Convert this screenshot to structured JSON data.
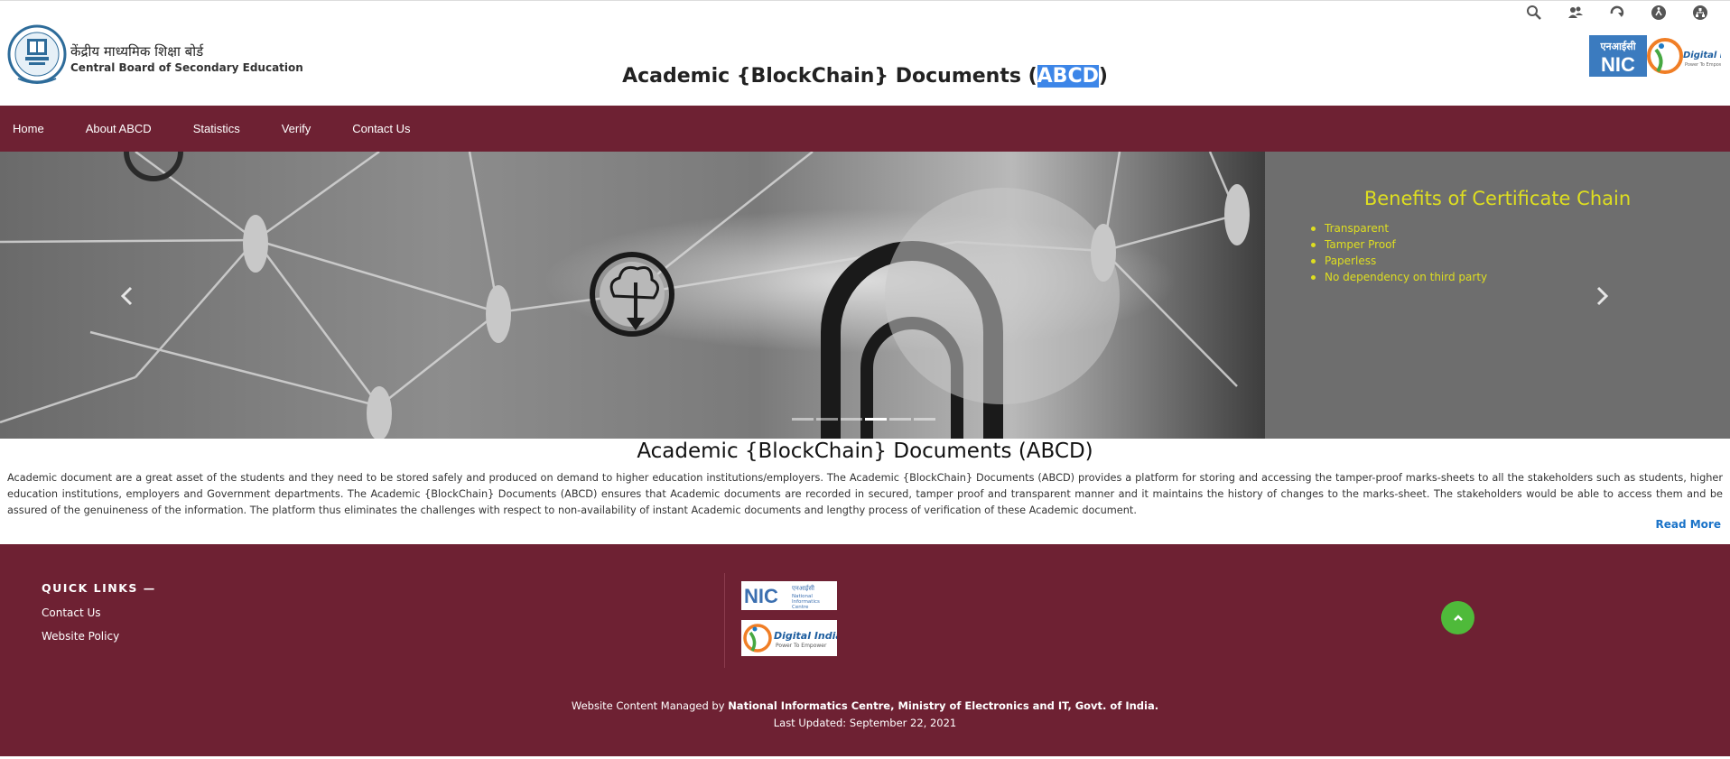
{
  "header": {
    "board_name_hindi": "केंद्रीय माध्यमिक शिक्षा बोर्ड",
    "board_name_english": "Central Board of Secondary Education",
    "title_prefix": "Academic {BlockChain} Documents (",
    "title_highlight": "ABCD",
    "title_suffix": ")",
    "utility_icons": [
      "search-icon",
      "users-icon",
      "refresh-icon",
      "accessibility-icon",
      "sitemap-icon"
    ],
    "nic_logo_text": "एनआईसी NIC",
    "digital_india_text": "Digital India",
    "digital_india_tagline": "Power To Empower"
  },
  "nav": {
    "items": [
      "Home",
      "About ABCD",
      "Statistics",
      "Verify",
      "Contact Us"
    ]
  },
  "carousel": {
    "benefits_title": "Benefits of Certificate Chain",
    "benefits": [
      "Transparent",
      "Tamper Proof",
      "Paperless",
      "No dependency on third party"
    ],
    "indicator_count": 6,
    "active_indicator": 4
  },
  "about": {
    "title": "Academic {BlockChain} Documents (ABCD)",
    "text": "Academic document are a great asset of the students and they need to be stored safely and produced on demand to higher education institutions/employers. The Academic {BlockChain} Documents (ABCD) provides a platform for storing and accessing the tamper-proof marks-sheets to all the stakeholders such as students, higher education institutions, employers and Government departments. The Academic {BlockChain} Documents (ABCD) ensures that Academic documents are recorded in secured, tamper proof and transparent manner and it maintains the history of changes to the marks-sheet. The stakeholders would be able to access them and be assured of the genuineness of the information. The platform thus eliminates the challenges with respect to non-availability of instant Academic documents and lengthy process of verification of these Academic document.",
    "read_more": "Read More"
  },
  "footer": {
    "quick_links_title": "QUICK LINKS —",
    "links": [
      "Contact Us",
      "Website Policy"
    ],
    "nic_logo_hindi": "एनआईसी",
    "nic_logo_sub": "National Informatics Centre",
    "digital_india_text": "Digital India",
    "digital_india_tagline": "Power To Empower",
    "managed_prefix": "Website Content Managed by ",
    "managed_org": "National Informatics Centre, Ministry of Electronics and IT, Govt. of India.",
    "last_updated": "Last Updated: September 22, 2021"
  },
  "colors": {
    "brand_maroon": "#6e2133",
    "benefits_yellow": "#dede20",
    "link_blue": "#1a73c8",
    "scroll_green": "#4fba3a",
    "highlight_blue": "#3d86e8"
  }
}
